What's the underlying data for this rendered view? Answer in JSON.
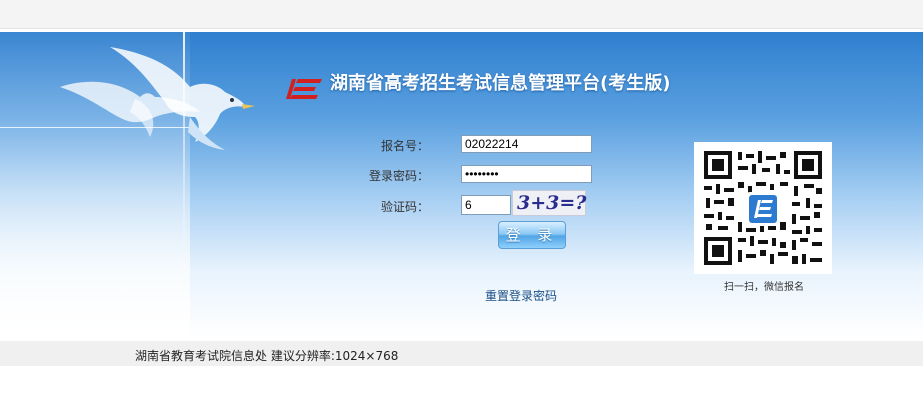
{
  "header": {
    "title": "湖南省高考招生考试信息管理平台(考生版)",
    "logo_icon": "hunan-exam-logo"
  },
  "login_form": {
    "registration_label": "报名号：",
    "registration_value": "02022214",
    "password_label": "登录密码：",
    "password_value": "********",
    "captcha_label": "验证码：",
    "captcha_value": "6",
    "captcha_image_text": "3+3=?",
    "login_button": "登 录",
    "reset_password_link": "重置登录密码"
  },
  "qr": {
    "caption": "扫一扫，微信报名"
  },
  "footer": {
    "text": "湖南省教育考试院信息处  建议分辨率:1024×768"
  },
  "colors": {
    "banner_top": "#2f7fcf",
    "title": "#ffffff",
    "logo_red": "#d21f1f",
    "link": "#1c4f86"
  }
}
